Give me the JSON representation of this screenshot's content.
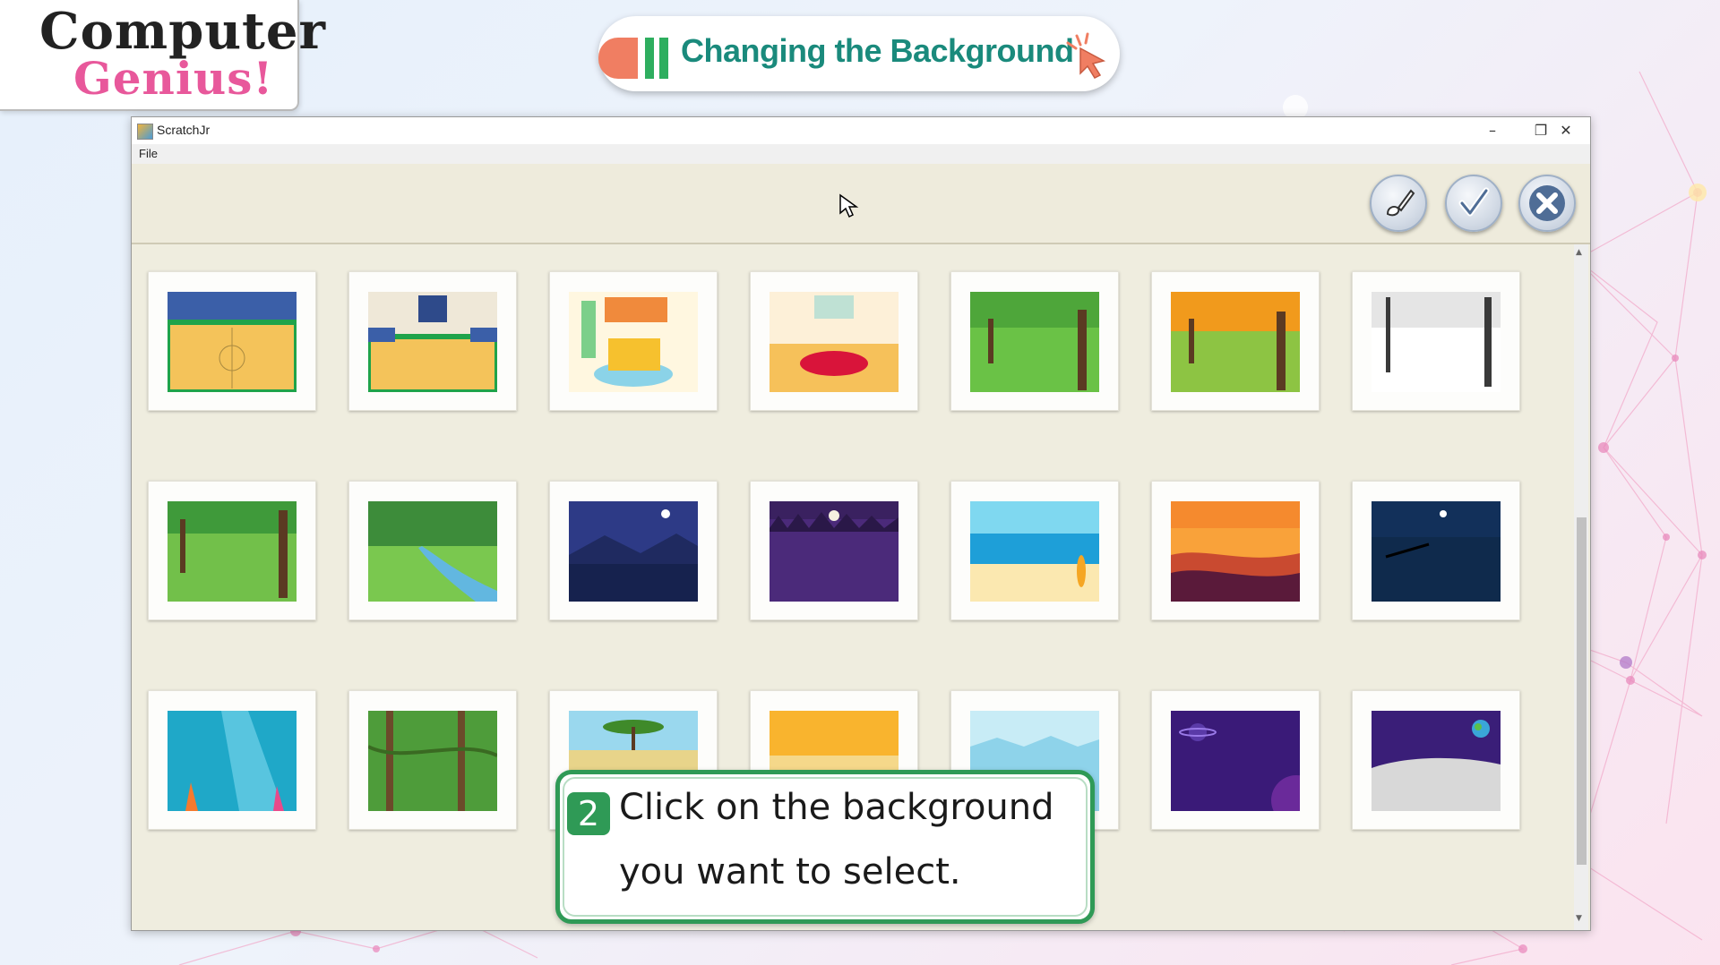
{
  "logo": {
    "line1": "Computer",
    "line2": "Genius!"
  },
  "lesson_title": "Changing the Background",
  "window": {
    "title": "ScratchJr",
    "controls": {
      "minimize": "–",
      "restore": "❐",
      "close": "✕"
    },
    "menu": {
      "file": "File"
    }
  },
  "toolbar": {
    "buttons": [
      {
        "name": "paint-editor",
        "icon": "paintbrush-icon"
      },
      {
        "name": "confirm",
        "icon": "checkmark-icon"
      },
      {
        "name": "cancel",
        "icon": "x-icon"
      }
    ]
  },
  "backgrounds": [
    "basketball-court-side",
    "basketball-court-front",
    "bedroom",
    "room-with-rug",
    "park",
    "autumn-park",
    "winter-park",
    "forest-clearing",
    "forest-stream",
    "night-lake",
    "night-forest",
    "beach",
    "sunset-sea",
    "night-sea-pier",
    "underwater",
    "jungle",
    "savanna",
    "desert",
    "arctic",
    "space",
    "moon"
  ],
  "callout": {
    "step": "2",
    "line1": "Click on the background",
    "line2": "you want to select."
  },
  "colors": {
    "accent_green": "#2f9a56",
    "title_teal": "#1a8a7c",
    "logo_pink": "#e8589b",
    "coral": "#f07e62"
  }
}
